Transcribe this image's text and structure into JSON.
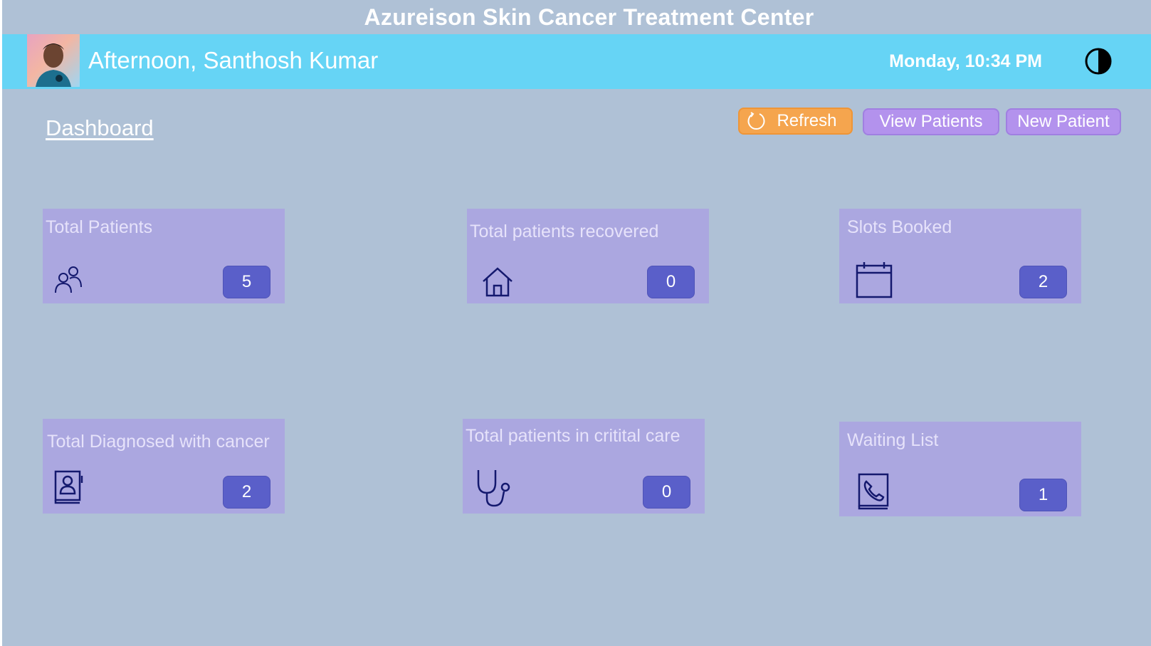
{
  "app": {
    "title": "Azureison Skin Cancer Treatment Center"
  },
  "header": {
    "greeting": "Afternoon, Santhosh Kumar",
    "datetime": "Monday, 10:34 PM",
    "avatar_icon": "user-photo",
    "theme_icon": "contrast-icon"
  },
  "page": {
    "title": "Dashboard"
  },
  "actions": {
    "refresh": "Refresh",
    "view_patients": "View Patients",
    "new_patient": "New Patient"
  },
  "cards": [
    {
      "title": "Total Patients",
      "value": "5",
      "icon": "people-icon"
    },
    {
      "title": "Total patients recovered",
      "value": "0",
      "icon": "home-icon"
    },
    {
      "title": "Slots Booked",
      "value": "2",
      "icon": "calendar-icon"
    },
    {
      "title": "Total Diagnosed with cancer",
      "value": "2",
      "icon": "contact-book-icon"
    },
    {
      "title": "Total patients in critital care",
      "value": "0",
      "icon": "stethoscope-icon"
    },
    {
      "title": "Waiting List",
      "value": "1",
      "icon": "phone-book-icon"
    }
  ],
  "colors": {
    "background": "#afc1d6",
    "header": "#66d4f5",
    "card": "#aba7e0",
    "badge": "#5a5fc9",
    "refresh": "#f5a54e",
    "button": "#b392ed",
    "icon": "#14196e"
  }
}
